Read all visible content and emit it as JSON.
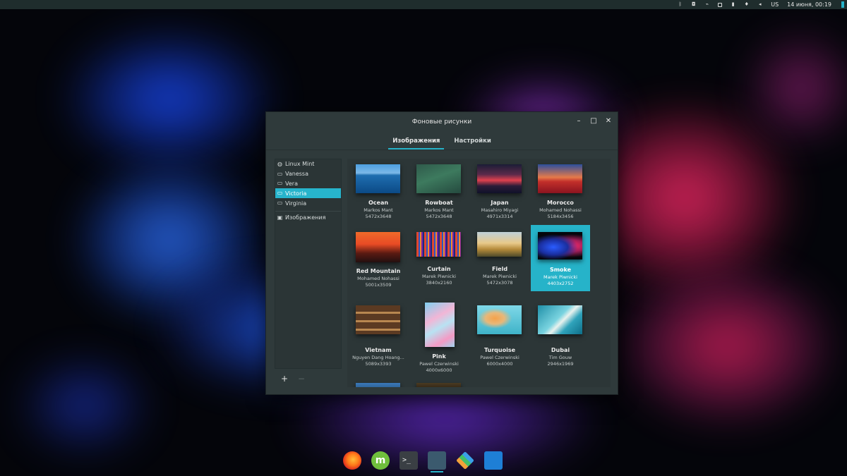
{
  "top_panel": {
    "keyboard_layout": "US",
    "datetime": "14 июня, 00:19",
    "tray_icons": [
      "bluetooth-icon",
      "shield-icon",
      "network-icon",
      "clipboard-icon",
      "battery-icon",
      "notification-icon",
      "volume-icon"
    ]
  },
  "window": {
    "title": "Фоновые рисунки",
    "controls": {
      "minimize": "–",
      "maximize": "□",
      "close": "✕"
    },
    "tabs": [
      {
        "label": "Изображения",
        "active": true
      },
      {
        "label": "Настройки",
        "active": false
      }
    ]
  },
  "sidebar": {
    "items": [
      {
        "label": "Linux Mint",
        "icon": "mint-logo-icon",
        "selected": false
      },
      {
        "label": "Vanessa",
        "icon": "monitor-icon",
        "selected": false
      },
      {
        "label": "Vera",
        "icon": "monitor-icon",
        "selected": false
      },
      {
        "label": "Victoria",
        "icon": "monitor-icon",
        "selected": true
      },
      {
        "label": "Virginia",
        "icon": "monitor-icon",
        "selected": false
      }
    ],
    "folder_item": {
      "label": "Изображения",
      "icon": "image-icon"
    },
    "add_label": "+",
    "remove_label": "−"
  },
  "wallpapers": [
    {
      "name": "Ocean",
      "author": "Markos Mant",
      "resolution": "5472x3648"
    },
    {
      "name": "Rowboat",
      "author": "Markos Mant",
      "resolution": "5472x3648"
    },
    {
      "name": "Japan",
      "author": "Masahiro Miyagi",
      "resolution": "4971x3314"
    },
    {
      "name": "Morocco",
      "author": "Mohamed Nohassi",
      "resolution": "5184x3456"
    },
    {
      "name": "Red Mountain",
      "author": "Mohamed Nohassi",
      "resolution": "5001x3509"
    },
    {
      "name": "Curtain",
      "author": "Marek Piwnicki",
      "resolution": "3840x2160"
    },
    {
      "name": "Field",
      "author": "Marek Piwnicki",
      "resolution": "5472x3078"
    },
    {
      "name": "Smoke",
      "author": "Marek Piwnicki",
      "resolution": "4403x2752",
      "selected": true
    },
    {
      "name": "Vietnam",
      "author": "Nguyen Dang Hoang...",
      "resolution": "5089x3393"
    },
    {
      "name": "Pink",
      "author": "Pawel Czerwinski",
      "resolution": "4000x6000"
    },
    {
      "name": "Turquoise",
      "author": "Pawel Czerwinski",
      "resolution": "6000x4000"
    },
    {
      "name": "Dubai",
      "author": "Tim Gouw",
      "resolution": "2946x1969"
    }
  ],
  "accent_color": "#26b3c9",
  "dock": [
    "firefox-icon",
    "linux-mint-icon",
    "terminal-icon",
    "notes-icon",
    "layers-icon",
    "files-icon"
  ]
}
